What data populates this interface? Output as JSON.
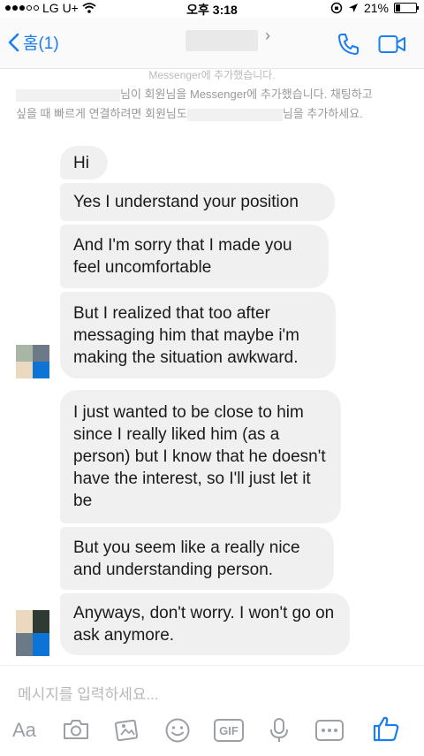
{
  "status_bar": {
    "carrier": "LG U+",
    "time": "오후 3:18",
    "battery_percent": "21%",
    "battery_level": 0.21
  },
  "nav": {
    "back_label": "홈(1)",
    "accent_color": "#1a7df5"
  },
  "notice": {
    "faded_line": "Messenger에 추가했습니다.",
    "line1_text": "님이 회원님을 Messenger에 추가했습니다. 채팅하고",
    "line2_start": "싶을 때 빠르게 연결하려면 회원님도",
    "line2_end": "님을 추가하세요."
  },
  "messages": [
    {
      "text": "Hi"
    },
    {
      "text": "Yes I understand your position"
    },
    {
      "text": "And I'm sorry that I made you feel uncomfortable"
    },
    {
      "text": "But I realized that too after messaging him that maybe i'm making the situation awkward."
    },
    {
      "text": "I just wanted to be close to him since I really liked him (as a person) but I know that he doesn't have the interest, so I'll just let it be"
    },
    {
      "text": "But you seem like a really nice and understanding person."
    },
    {
      "text": "Anyways, don't worry. I won't go on ask anymore."
    }
  ],
  "composer": {
    "placeholder": "메시지를 입력하세요...",
    "aa_label": "Aa",
    "gif_label": "GIF",
    "icons": [
      "text-style-icon",
      "camera-icon",
      "photo-gallery-icon",
      "emoji-icon",
      "gif-icon",
      "microphone-icon",
      "more-icon",
      "thumbs-up-icon"
    ]
  }
}
